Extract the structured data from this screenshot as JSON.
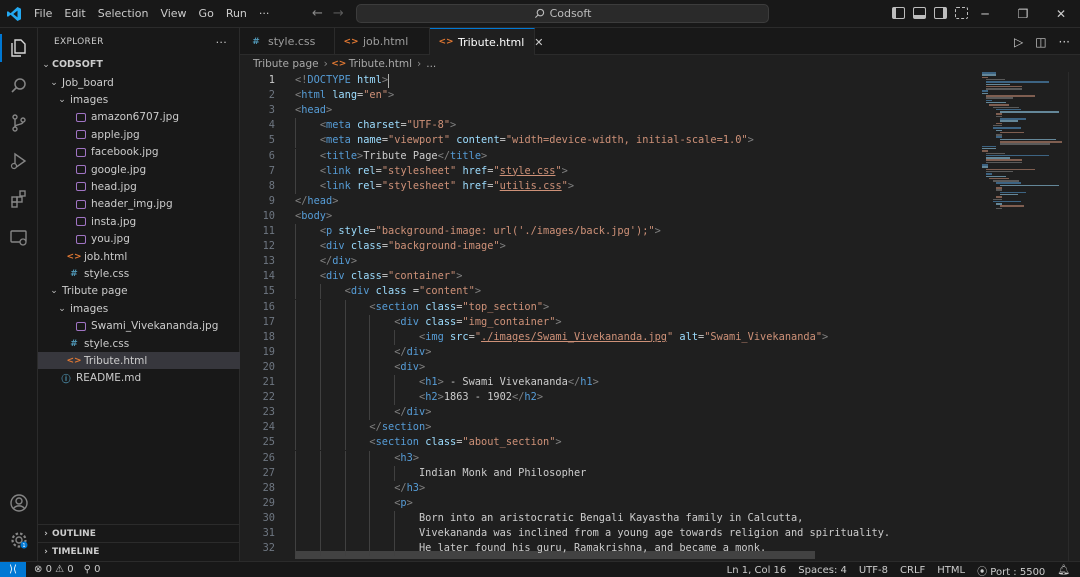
{
  "titlebar": {
    "menu": [
      "File",
      "Edit",
      "Selection",
      "View",
      "Go",
      "Run",
      "···"
    ],
    "search": "Codsoft"
  },
  "explorer": {
    "title": "EXPLORER",
    "more": "···",
    "root": "CODSOFT",
    "items": [
      {
        "label": "Job_board",
        "kind": "folder",
        "depth": 1,
        "open": true
      },
      {
        "label": "images",
        "kind": "folder",
        "depth": 2,
        "open": true
      },
      {
        "label": "amazon6707.jpg",
        "kind": "img",
        "depth": 3
      },
      {
        "label": "apple.jpg",
        "kind": "img",
        "depth": 3
      },
      {
        "label": "facebook.jpg",
        "kind": "img",
        "depth": 3
      },
      {
        "label": "google.jpg",
        "kind": "img",
        "depth": 3
      },
      {
        "label": "head.jpg",
        "kind": "img",
        "depth": 3
      },
      {
        "label": "header_img.jpg",
        "kind": "img",
        "depth": 3
      },
      {
        "label": "insta.jpg",
        "kind": "img",
        "depth": 3
      },
      {
        "label": "you.jpg",
        "kind": "img",
        "depth": 3
      },
      {
        "label": "job.html",
        "kind": "html",
        "depth": 2
      },
      {
        "label": "style.css",
        "kind": "css",
        "depth": 2
      },
      {
        "label": "Tribute page",
        "kind": "folder",
        "depth": 1,
        "open": true
      },
      {
        "label": "images",
        "kind": "folder",
        "depth": 2,
        "open": true
      },
      {
        "label": "Swami_Vivekananda.jpg",
        "kind": "img",
        "depth": 3
      },
      {
        "label": "style.css",
        "kind": "css",
        "depth": 2
      },
      {
        "label": "Tribute.html",
        "kind": "html",
        "depth": 2,
        "selected": true
      },
      {
        "label": "README.md",
        "kind": "info",
        "depth": 1
      }
    ],
    "outline": "OUTLINE",
    "timeline": "TIMELINE"
  },
  "tabs": [
    {
      "label": "style.css",
      "kind": "css",
      "active": false
    },
    {
      "label": "job.html",
      "kind": "html",
      "active": false
    },
    {
      "label": "Tribute.html",
      "kind": "html",
      "active": true
    }
  ],
  "breadcrumb": [
    "Tribute page",
    "Tribute.html",
    "..."
  ],
  "code_lines": [
    [
      [
        "b",
        "<!"
      ],
      [
        "t",
        "DOCTYPE"
      ],
      [
        "x",
        " "
      ],
      [
        "a",
        "html"
      ],
      [
        "b",
        ">"
      ]
    ],
    [
      [
        "b",
        "<"
      ],
      [
        "t",
        "html"
      ],
      [
        "x",
        " "
      ],
      [
        "a",
        "lang"
      ],
      [
        "x",
        "="
      ],
      [
        "s",
        "\"en\""
      ],
      [
        "b",
        ">"
      ]
    ],
    [
      [
        "b",
        "<"
      ],
      [
        "t",
        "head"
      ],
      [
        "b",
        ">"
      ]
    ],
    [
      [
        "x",
        "    "
      ],
      [
        "b",
        "<"
      ],
      [
        "t",
        "meta"
      ],
      [
        "x",
        " "
      ],
      [
        "a",
        "charset"
      ],
      [
        "x",
        "="
      ],
      [
        "s",
        "\"UTF-8\""
      ],
      [
        "b",
        ">"
      ]
    ],
    [
      [
        "x",
        "    "
      ],
      [
        "b",
        "<"
      ],
      [
        "t",
        "meta"
      ],
      [
        "x",
        " "
      ],
      [
        "a",
        "name"
      ],
      [
        "x",
        "="
      ],
      [
        "s",
        "\"viewport\""
      ],
      [
        "x",
        " "
      ],
      [
        "a",
        "content"
      ],
      [
        "x",
        "="
      ],
      [
        "s",
        "\"width=device-width, initial-scale=1.0\""
      ],
      [
        "b",
        ">"
      ]
    ],
    [
      [
        "x",
        "    "
      ],
      [
        "b",
        "<"
      ],
      [
        "t",
        "title"
      ],
      [
        "b",
        ">"
      ],
      [
        "x",
        "Tribute Page"
      ],
      [
        "b",
        "</"
      ],
      [
        "t",
        "title"
      ],
      [
        "b",
        ">"
      ]
    ],
    [
      [
        "x",
        "    "
      ],
      [
        "b",
        "<"
      ],
      [
        "t",
        "link"
      ],
      [
        "x",
        " "
      ],
      [
        "a",
        "rel"
      ],
      [
        "x",
        "="
      ],
      [
        "s",
        "\"stylesheet\""
      ],
      [
        "x",
        " "
      ],
      [
        "a",
        "href"
      ],
      [
        "x",
        "="
      ],
      [
        "s",
        "\""
      ],
      [
        "su",
        "style.css"
      ],
      [
        "s",
        "\""
      ],
      [
        "b",
        ">"
      ]
    ],
    [
      [
        "x",
        "    "
      ],
      [
        "b",
        "<"
      ],
      [
        "t",
        "link"
      ],
      [
        "x",
        " "
      ],
      [
        "a",
        "rel"
      ],
      [
        "x",
        "="
      ],
      [
        "s",
        "\"stylesheet\""
      ],
      [
        "x",
        " "
      ],
      [
        "a",
        "href"
      ],
      [
        "x",
        "="
      ],
      [
        "s",
        "\""
      ],
      [
        "su",
        "utilis.css"
      ],
      [
        "s",
        "\""
      ],
      [
        "b",
        ">"
      ]
    ],
    [
      [
        "b",
        "</"
      ],
      [
        "t",
        "head"
      ],
      [
        "b",
        ">"
      ]
    ],
    [
      [
        "b",
        "<"
      ],
      [
        "t",
        "body"
      ],
      [
        "b",
        ">"
      ]
    ],
    [
      [
        "x",
        "    "
      ],
      [
        "b",
        "<"
      ],
      [
        "t",
        "p"
      ],
      [
        "x",
        " "
      ],
      [
        "a",
        "style"
      ],
      [
        "x",
        "="
      ],
      [
        "s",
        "\"background-image: url('./images/back.jpg');\""
      ],
      [
        "b",
        ">"
      ]
    ],
    [
      [
        "x",
        "    "
      ],
      [
        "b",
        "<"
      ],
      [
        "t",
        "div"
      ],
      [
        "x",
        " "
      ],
      [
        "a",
        "class"
      ],
      [
        "x",
        "="
      ],
      [
        "s",
        "\"background-image\""
      ],
      [
        "b",
        ">"
      ]
    ],
    [
      [
        "x",
        "    "
      ],
      [
        "b",
        "</"
      ],
      [
        "t",
        "div"
      ],
      [
        "b",
        ">"
      ]
    ],
    [
      [
        "x",
        "    "
      ],
      [
        "b",
        "<"
      ],
      [
        "t",
        "div"
      ],
      [
        "x",
        " "
      ],
      [
        "a",
        "class"
      ],
      [
        "x",
        "="
      ],
      [
        "s",
        "\"container\""
      ],
      [
        "b",
        ">"
      ]
    ],
    [
      [
        "x",
        "        "
      ],
      [
        "b",
        "<"
      ],
      [
        "t",
        "div"
      ],
      [
        "x",
        " "
      ],
      [
        "a",
        "class"
      ],
      [
        "x",
        " ="
      ],
      [
        "s",
        "\"content\""
      ],
      [
        "b",
        ">"
      ]
    ],
    [
      [
        "x",
        "            "
      ],
      [
        "b",
        "<"
      ],
      [
        "t",
        "section"
      ],
      [
        "x",
        " "
      ],
      [
        "a",
        "class"
      ],
      [
        "x",
        "="
      ],
      [
        "s",
        "\"top_section\""
      ],
      [
        "b",
        ">"
      ]
    ],
    [
      [
        "x",
        "                "
      ],
      [
        "b",
        "<"
      ],
      [
        "t",
        "div"
      ],
      [
        "x",
        " "
      ],
      [
        "a",
        "class"
      ],
      [
        "x",
        "="
      ],
      [
        "s",
        "\"img_container\""
      ],
      [
        "b",
        ">"
      ]
    ],
    [
      [
        "x",
        "                    "
      ],
      [
        "b",
        "<"
      ],
      [
        "t",
        "img"
      ],
      [
        "x",
        " "
      ],
      [
        "a",
        "src"
      ],
      [
        "x",
        "="
      ],
      [
        "s",
        "\""
      ],
      [
        "su",
        "./images/Swami_Vivekananda.jpg"
      ],
      [
        "s",
        "\""
      ],
      [
        "x",
        " "
      ],
      [
        "a",
        "alt"
      ],
      [
        "x",
        "="
      ],
      [
        "s",
        "\"Swami_Vivekananda\""
      ],
      [
        "b",
        ">"
      ]
    ],
    [
      [
        "x",
        "                "
      ],
      [
        "b",
        "</"
      ],
      [
        "t",
        "div"
      ],
      [
        "b",
        ">"
      ]
    ],
    [
      [
        "x",
        "                "
      ],
      [
        "b",
        "<"
      ],
      [
        "t",
        "div"
      ],
      [
        "b",
        ">"
      ]
    ],
    [
      [
        "x",
        "                    "
      ],
      [
        "b",
        "<"
      ],
      [
        "t",
        "h1"
      ],
      [
        "b",
        ">"
      ],
      [
        "x",
        " - Swami Vivekananda"
      ],
      [
        "b",
        "</"
      ],
      [
        "t",
        "h1"
      ],
      [
        "b",
        ">"
      ]
    ],
    [
      [
        "x",
        "                    "
      ],
      [
        "b",
        "<"
      ],
      [
        "t",
        "h2"
      ],
      [
        "b",
        ">"
      ],
      [
        "x",
        "1863 - 1902"
      ],
      [
        "b",
        "</"
      ],
      [
        "t",
        "h2"
      ],
      [
        "b",
        ">"
      ]
    ],
    [
      [
        "x",
        "                "
      ],
      [
        "b",
        "</"
      ],
      [
        "t",
        "div"
      ],
      [
        "b",
        ">"
      ]
    ],
    [
      [
        "x",
        "            "
      ],
      [
        "b",
        "</"
      ],
      [
        "t",
        "section"
      ],
      [
        "b",
        ">"
      ]
    ],
    [
      [
        "x",
        "            "
      ],
      [
        "b",
        "<"
      ],
      [
        "t",
        "section"
      ],
      [
        "x",
        " "
      ],
      [
        "a",
        "class"
      ],
      [
        "x",
        "="
      ],
      [
        "s",
        "\"about_section\""
      ],
      [
        "b",
        ">"
      ]
    ],
    [
      [
        "x",
        "                "
      ],
      [
        "b",
        "<"
      ],
      [
        "t",
        "h3"
      ],
      [
        "b",
        ">"
      ]
    ],
    [
      [
        "x",
        "                    Indian Monk and Philosopher"
      ]
    ],
    [
      [
        "x",
        "                "
      ],
      [
        "b",
        "</"
      ],
      [
        "t",
        "h3"
      ],
      [
        "b",
        ">"
      ]
    ],
    [
      [
        "x",
        "                "
      ],
      [
        "b",
        "<"
      ],
      [
        "t",
        "p"
      ],
      [
        "b",
        ">"
      ]
    ],
    [
      [
        "x",
        "                    Born into an aristocratic Bengali Kayastha family in Calcutta,"
      ]
    ],
    [
      [
        "x",
        "                    Vivekananda was inclined from a young age towards religion and spirituality."
      ]
    ],
    [
      [
        "x",
        "                    He later found his guru, Ramakrishna, and became a monk."
      ]
    ]
  ],
  "statusbar": {
    "errors": "0",
    "warnings": "0",
    "ports_icon_count": "0",
    "position": "Ln 1, Col 16",
    "spaces": "Spaces: 4",
    "encoding": "UTF-8",
    "eol": "CRLF",
    "language": "HTML",
    "port": "Port : 5500"
  }
}
